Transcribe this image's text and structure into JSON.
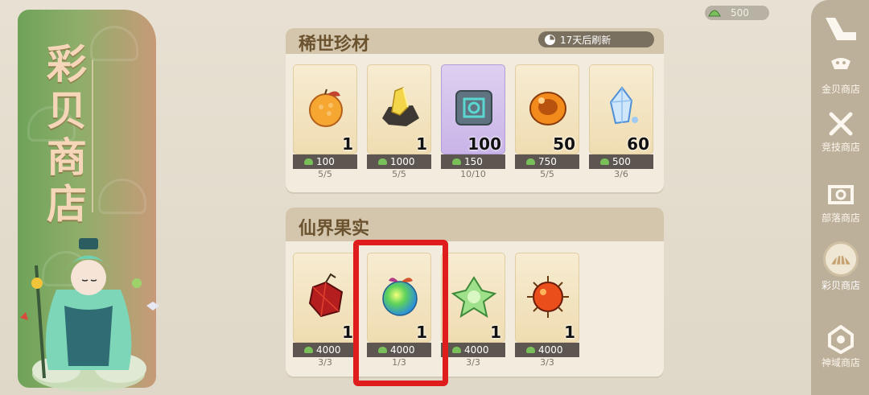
{
  "banner": {
    "title_chars": [
      "彩",
      "贝",
      "商",
      "店"
    ]
  },
  "currency": {
    "icon": "shell-currency-icon",
    "amount": "500"
  },
  "rare_section": {
    "title": "稀世珍材",
    "refresh": "17天后刷新",
    "items": [
      {
        "icon": "orange-fruit-icon",
        "qty": "1",
        "price": "100",
        "limit": "5/5"
      },
      {
        "icon": "gold-crystal-ore-icon",
        "qty": "1",
        "price": "1000",
        "limit": "5/5"
      },
      {
        "icon": "rune-stone-icon",
        "qty": "100",
        "price": "150",
        "limit": "10/10"
      },
      {
        "icon": "amber-stone-icon",
        "qty": "50",
        "price": "750",
        "limit": "5/5"
      },
      {
        "icon": "ice-crystal-icon",
        "qty": "60",
        "price": "500",
        "limit": "3/6"
      }
    ]
  },
  "fruit_section": {
    "title": "仙界果实",
    "items": [
      {
        "icon": "red-fruit-icon",
        "qty": "1",
        "price": "4000",
        "limit": "3/3"
      },
      {
        "icon": "rainbow-fruit-icon",
        "qty": "1",
        "price": "4000",
        "limit": "1/3"
      },
      {
        "icon": "green-leaf-fruit-icon",
        "qty": "1",
        "price": "4000",
        "limit": "3/3"
      },
      {
        "icon": "spiky-fire-fruit-icon",
        "qty": "1",
        "price": "4000",
        "limit": "3/3"
      }
    ]
  },
  "sidebar": {
    "items": [
      {
        "label": "金贝商店",
        "icon": "gold-shell-icon"
      },
      {
        "label": "竞技商店",
        "icon": "crossed-swords-icon"
      },
      {
        "label": "部落商店",
        "icon": "tribe-shield-icon"
      },
      {
        "label": "彩贝商店",
        "icon": "color-shell-icon",
        "active": true
      },
      {
        "label": "神域商店",
        "icon": "divine-gem-icon"
      }
    ]
  },
  "colors": {
    "highlight": "#e01d1d",
    "banner_green": "#6fa35a",
    "price_bar": "#5d5650"
  }
}
